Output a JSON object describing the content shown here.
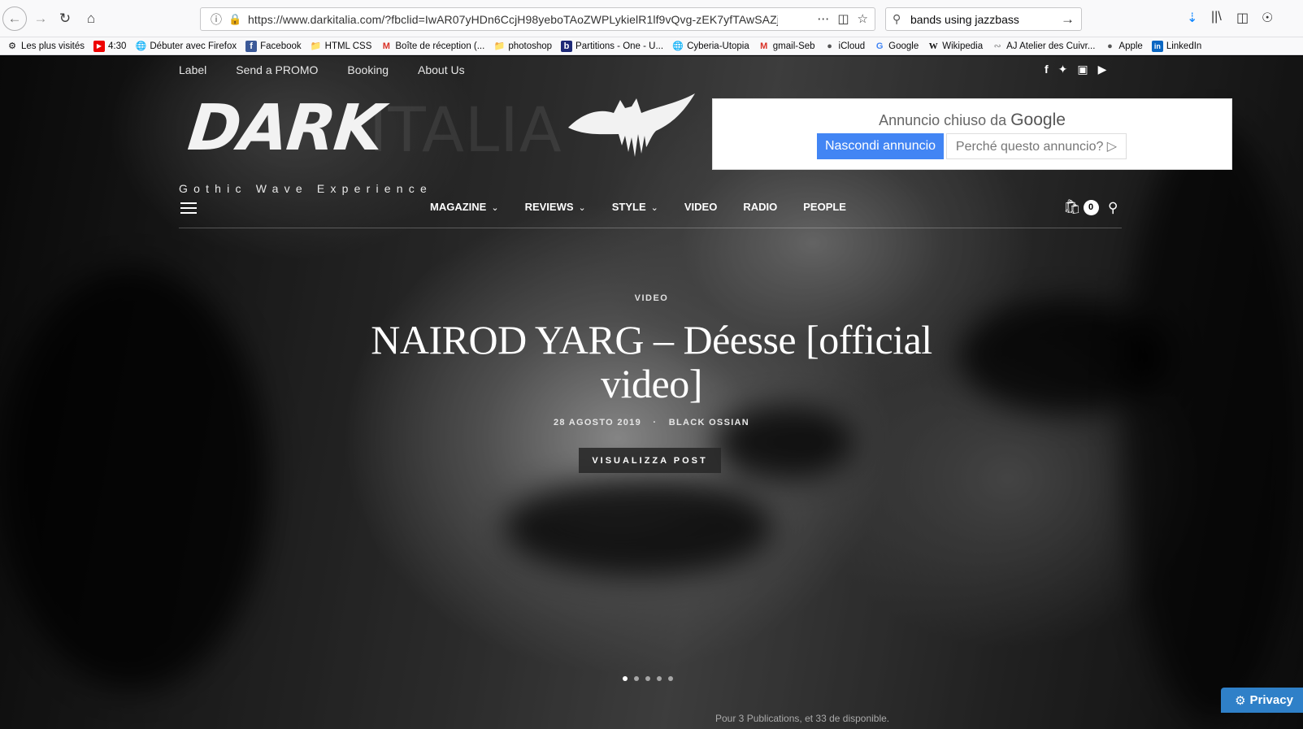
{
  "browser": {
    "url": "https://www.darkitalia.com/?fbclid=IwAR07yHDn6CcjH98yeboTAoZWPLykielR1lf9vQvg-zEK7yfTAwSAZj",
    "search_query": "bands using jazzbass",
    "icons": [
      "back-icon",
      "forward-icon",
      "reload-icon",
      "home-icon",
      "info-icon",
      "lock-icon",
      "more-icon",
      "pocket-icon",
      "star-icon",
      "search-icon",
      "go-icon",
      "download-icon",
      "library-icon",
      "sidebar-icon",
      "account-icon"
    ]
  },
  "bookmarks": [
    {
      "label": "Les plus visités",
      "icon": "gear-icon"
    },
    {
      "label": "4:30",
      "icon": "youtube-icon"
    },
    {
      "label": "Débuter avec Firefox",
      "icon": "globe-icon"
    },
    {
      "label": "Facebook",
      "icon": "facebook-icon"
    },
    {
      "label": "HTML CSS",
      "icon": "folder-icon"
    },
    {
      "label": "Boîte de réception (...",
      "icon": "gmail-icon"
    },
    {
      "label": "photoshop",
      "icon": "folder-icon"
    },
    {
      "label": "Partitions - One - U...",
      "icon": "bookmark-icon"
    },
    {
      "label": "Cyberia-Utopia",
      "icon": "globe-icon"
    },
    {
      "label": "gmail-Seb",
      "icon": "gmail-icon"
    },
    {
      "label": "iCloud",
      "icon": "apple-icon"
    },
    {
      "label": "Google",
      "icon": "google-icon"
    },
    {
      "label": "Wikipedia",
      "icon": "wikipedia-icon"
    },
    {
      "label": "AJ Atelier des Cuivr...",
      "icon": "site-icon"
    },
    {
      "label": "Apple",
      "icon": "apple-icon"
    },
    {
      "label": "LinkedIn",
      "icon": "linkedin-icon"
    }
  ],
  "site": {
    "top_nav": [
      "Label",
      "Send a PROMO",
      "Booking",
      "About Us"
    ],
    "logo_dark": "DARK",
    "logo_italia": "ITALIA",
    "tagline": "Gothic Wave Experience",
    "main_nav": [
      {
        "label": "MAGAZINE",
        "dropdown": true
      },
      {
        "label": "REVIEWS",
        "dropdown": true
      },
      {
        "label": "STYLE",
        "dropdown": true
      },
      {
        "label": "VIDEO",
        "dropdown": false
      },
      {
        "label": "RADIO",
        "dropdown": false
      },
      {
        "label": "PEOPLE",
        "dropdown": false
      }
    ],
    "cart_count": "0"
  },
  "ad": {
    "closed_text": "Annuncio chiuso da",
    "brand": "Google",
    "hide_button": "Nascondi annuncio",
    "why_button": "Perché questo annuncio? ▷"
  },
  "hero": {
    "category": "VIDEO",
    "title_line1": "NAIROD YARG – Déesse [official",
    "title_line2": "video]",
    "date": "28 AGOSTO 2019",
    "author": "BLACK OSSIAN",
    "button": "VISUALIZZA POST",
    "slides_total": 5,
    "active_slide": 1
  },
  "privacy_label": "Privacy",
  "below_text": "Pour 3 Publications, et 33 de disponible."
}
